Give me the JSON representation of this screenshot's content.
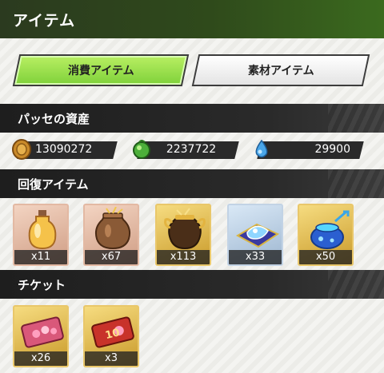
{
  "header": {
    "title": "アイテム"
  },
  "tabs": [
    {
      "label": "消費アイテム",
      "active": true
    },
    {
      "label": "素材アイテム",
      "active": false
    }
  ],
  "assets": {
    "heading": "パッセの資産",
    "currencies": [
      {
        "icon": "coin-icon",
        "value": "13090272"
      },
      {
        "icon": "green-orb-icon",
        "value": "2237722"
      },
      {
        "icon": "water-drop-icon",
        "value": "29900"
      }
    ]
  },
  "recovery": {
    "heading": "回復アイテム",
    "items": [
      {
        "icon": "potion-bottle-icon",
        "count": "x11"
      },
      {
        "icon": "clay-pot-icon",
        "count": "x67"
      },
      {
        "icon": "golden-urn-icon",
        "count": "x113"
      },
      {
        "icon": "blue-crystal-cushion-icon",
        "count": "x33"
      },
      {
        "icon": "blue-jewel-pot-icon",
        "count": "x50"
      }
    ]
  },
  "tickets": {
    "heading": "チケット",
    "items": [
      {
        "icon": "pink-ticket-icon",
        "count": "x26"
      },
      {
        "icon": "red-ticket-10-icon",
        "count": "x3",
        "badge": "10"
      }
    ]
  },
  "colors": {
    "accent": "#8ad83f",
    "header_bg": "#2f4a1b",
    "section_bg": "#222222"
  }
}
